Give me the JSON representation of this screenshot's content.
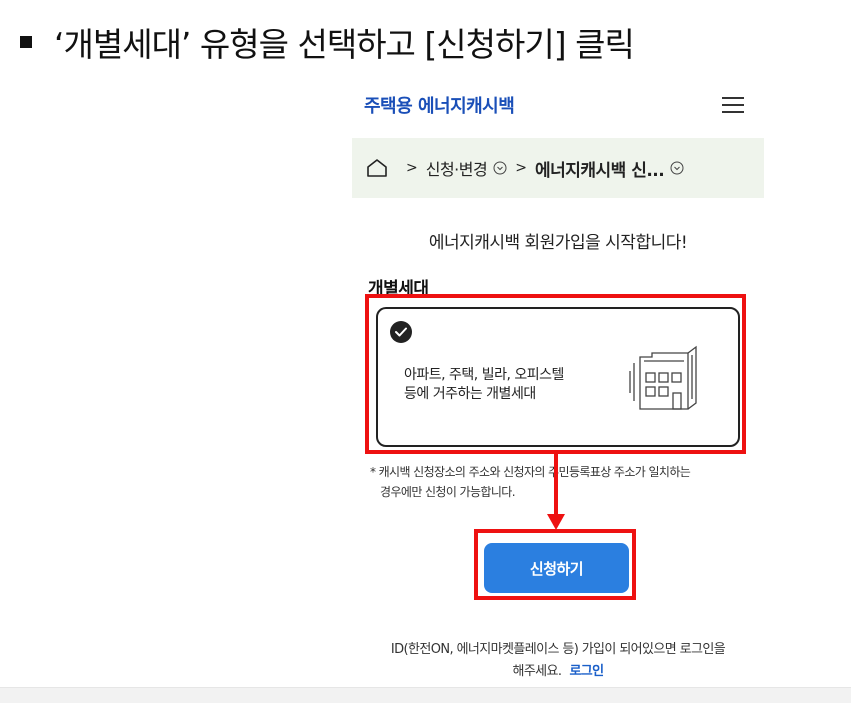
{
  "instruction": {
    "text": "‘개별세대’ 유형을 선택하고 [신청하기] 클릭"
  },
  "header": {
    "brand": "주택용 에너지캐시백",
    "menu_icon": "hamburger-menu-icon"
  },
  "breadcrumb": {
    "home_icon": "home-icon",
    "item1": "신청·변경",
    "item2": "에너지캐시백 신...",
    "separator": ">"
  },
  "main": {
    "headline": "에너지캐시백 회원가입을 시작합니다!",
    "section_title": "개별세대",
    "card": {
      "line1": "아파트, 주택, 빌라, 오피스텔",
      "line2": "등에 거주하는 개별세대",
      "icon": "building-icon"
    },
    "notice_line1": "* 캐시백 신청장소의 주소와 신청자의 주민등록표상 주소가 일치하는",
    "notice_line2": "경우에만 신청이 가능합니다.",
    "apply_button": "신청하기",
    "footer_line1": "ID(한전ON, 에너지마켓플레이스 등) 가입이 되어있으면 로그인을",
    "footer_line2": "해주세요.",
    "login_link": "로그인"
  },
  "colors": {
    "brand": "#1a4fb8",
    "button": "#2b7fe0",
    "highlight": "#ee1111",
    "breadcrumb_bg": "#eff4ec",
    "link": "#1a5fc9"
  }
}
